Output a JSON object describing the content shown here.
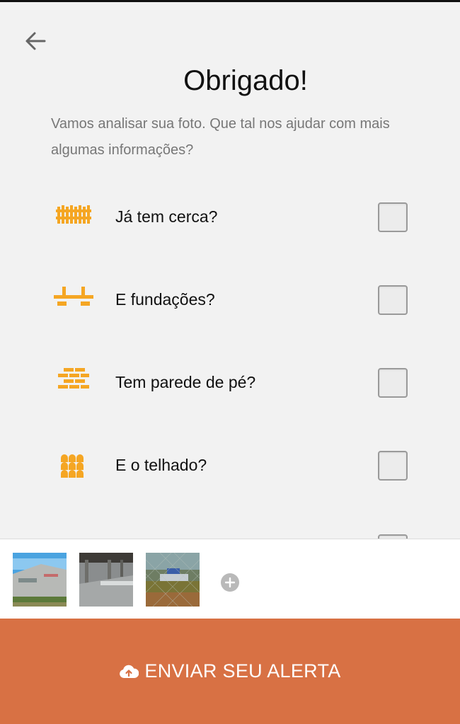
{
  "header": {
    "back_icon": "arrow-left-icon",
    "title": "Obrigado!",
    "subtitle": "Vamos analisar sua foto. Que tal nos ajudar com mais algumas informações?"
  },
  "questions": [
    {
      "label": "Já tem cerca?",
      "icon": "fence-icon",
      "checked": false
    },
    {
      "label": "E fundações?",
      "icon": "foundation-icon",
      "checked": false
    },
    {
      "label": "Tem parede de pé?",
      "icon": "brick-wall-icon",
      "checked": false
    },
    {
      "label": "E o telhado?",
      "icon": "roof-tiles-icon",
      "checked": false
    }
  ],
  "photos": {
    "count": 3,
    "add_icon": "plus-circle-icon"
  },
  "submit": {
    "label": "ENVIAR SEU ALERTA",
    "icon": "cloud-upload-icon"
  },
  "colors": {
    "accent": "#d87144",
    "icon_orange": "#f5a623",
    "background": "#f2f2f2"
  }
}
